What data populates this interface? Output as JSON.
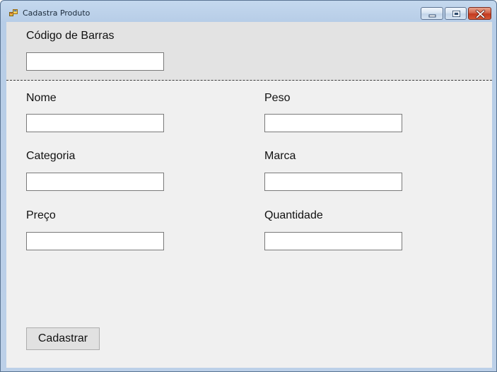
{
  "window": {
    "title": "Cadastra Produto",
    "app_icon": "winforms-app-icon",
    "controls": [
      "minimize-icon",
      "maximize-icon",
      "close-icon"
    ]
  },
  "barcode": {
    "label": "Código de Barras",
    "value": ""
  },
  "form": {
    "nome": {
      "label": "Nome",
      "value": ""
    },
    "peso": {
      "label": "Peso",
      "value": ""
    },
    "categoria": {
      "label": "Categoria",
      "value": ""
    },
    "marca": {
      "label": "Marca",
      "value": ""
    },
    "preco": {
      "label": "Preço",
      "value": ""
    },
    "quantidade": {
      "label": "Quantidade",
      "value": ""
    }
  },
  "actions": {
    "submit_label": "Cadastrar"
  },
  "colors": {
    "titlebar": "#bcd0e8",
    "client_background": "#f0f0f0",
    "top_panel": "#e3e3e3",
    "close_button": "#c3391f"
  }
}
